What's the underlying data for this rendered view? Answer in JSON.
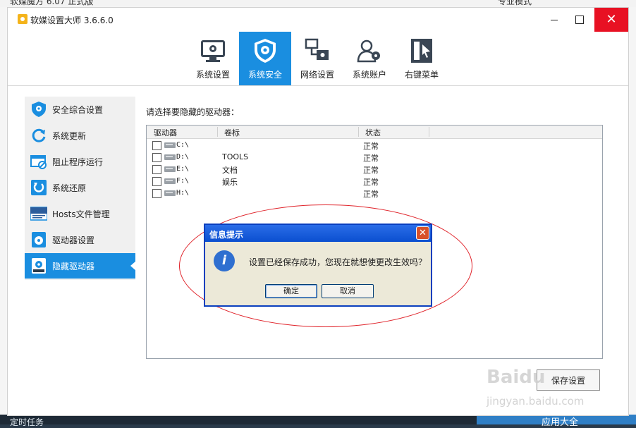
{
  "background": {
    "top_left_text": "软媒魔方 6.07 正式版",
    "top_right_text": "专业模式",
    "bottom_task": "定时任务",
    "bottom_apply": "应用大全"
  },
  "window": {
    "title": "软媒设置大师 3.6.6.0",
    "close_glyph": "✕"
  },
  "toolbar": {
    "items": [
      {
        "label": "系统设置"
      },
      {
        "label": "系统安全"
      },
      {
        "label": "网络设置"
      },
      {
        "label": "系统账户"
      },
      {
        "label": "右键菜单"
      }
    ]
  },
  "sidebar": {
    "items": [
      {
        "label": "安全综合设置"
      },
      {
        "label": "系统更新"
      },
      {
        "label": "阻止程序运行"
      },
      {
        "label": "系统还原"
      },
      {
        "label": "Hosts文件管理"
      },
      {
        "label": "驱动器设置"
      },
      {
        "label": "隐藏驱动器"
      }
    ]
  },
  "content": {
    "prompt": "请选择要隐藏的驱动器：",
    "columns": [
      "驱动器",
      "卷标",
      "状态"
    ],
    "rows": [
      {
        "drive": "C:\\",
        "volume": "",
        "status": "正常"
      },
      {
        "drive": "D:\\",
        "volume": "TOOLS",
        "status": "正常"
      },
      {
        "drive": "E:\\",
        "volume": "文档",
        "status": "正常"
      },
      {
        "drive": "F:\\",
        "volume": "娱乐",
        "status": "正常"
      },
      {
        "drive": "H:\\",
        "volume": "",
        "status": "正常"
      }
    ],
    "save_button": "保存设置"
  },
  "dialog": {
    "title": "信息提示",
    "message": "设置已经保存成功，您现在就想使更改生效吗？",
    "ok": "确定",
    "cancel": "取消",
    "close_glyph": "✕",
    "info_glyph": "i"
  },
  "watermark": {
    "brand": "Baidu",
    "site": "jingyan.baidu.com"
  },
  "colors": {
    "accent": "#1a8ee0",
    "close_red": "#e81123",
    "annotation": "#e0242b",
    "dialog_title": "#0b4fd0"
  }
}
